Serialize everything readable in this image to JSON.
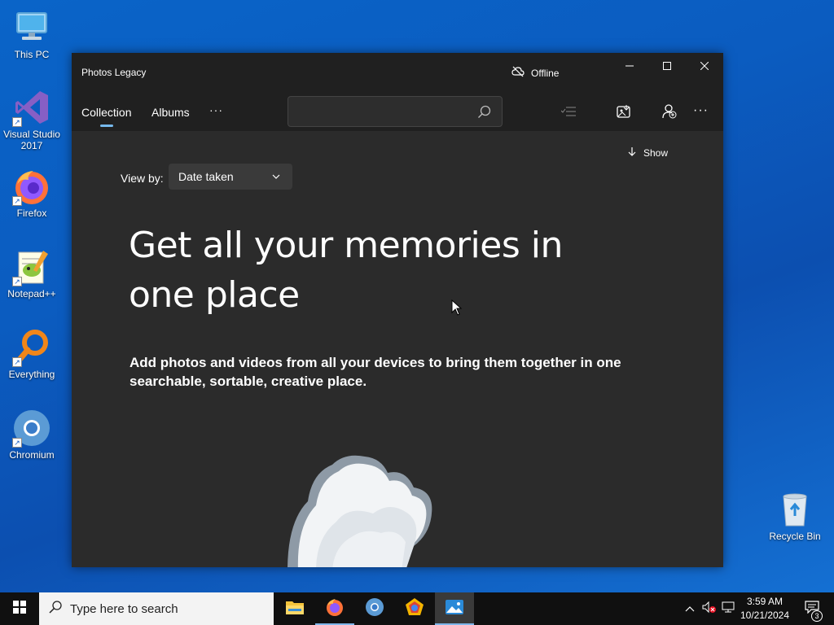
{
  "desktop": {
    "icons": [
      {
        "label": "This PC",
        "icon": "computer-icon"
      },
      {
        "label": "Visual Studio 2017",
        "icon": "visual-studio-icon"
      },
      {
        "label": "Firefox",
        "icon": "firefox-icon"
      },
      {
        "label": "Notepad++",
        "icon": "notepadpp-icon"
      },
      {
        "label": "Everything",
        "icon": "everything-search-icon"
      },
      {
        "label": "Chromium",
        "icon": "chromium-icon"
      }
    ],
    "recycle_bin": {
      "label": "Recycle Bin",
      "icon": "recycle-bin-icon"
    }
  },
  "window": {
    "title": "Photos Legacy",
    "status": "Offline",
    "controls": {
      "minimize": "minimize-icon",
      "maximize": "maximize-icon",
      "close": "close-icon"
    }
  },
  "nav": {
    "tabs": [
      {
        "label": "Collection",
        "active": true
      },
      {
        "label": "Albums",
        "active": false
      }
    ],
    "more": "···",
    "search": {
      "value": "",
      "placeholder": ""
    },
    "toolbar_icons": [
      "select-list-icon",
      "import-icon",
      "people-add-icon",
      "more-icon"
    ]
  },
  "content": {
    "show_label": "Show",
    "view_by_label": "View by:",
    "view_by_value": "Date taken",
    "headline": "Get all your memories in one place",
    "subline": "Add photos and videos from all your devices to bring them together in one searchable, sortable, creative place."
  },
  "taskbar": {
    "search_placeholder": "Type here to search",
    "apps": [
      "file-explorer-icon",
      "firefox-icon",
      "chromium-icon",
      "app-icon",
      "photos-icon"
    ],
    "clock_time": "3:59 AM",
    "clock_date": "10/21/2024",
    "notification_count": "3"
  },
  "colors": {
    "desktop_bg": "#0b5cc0",
    "window_bg": "#2b2b2b",
    "titlebar_bg": "#202020",
    "accent": "#76b9ed",
    "taskbar_bg": "#101010"
  }
}
